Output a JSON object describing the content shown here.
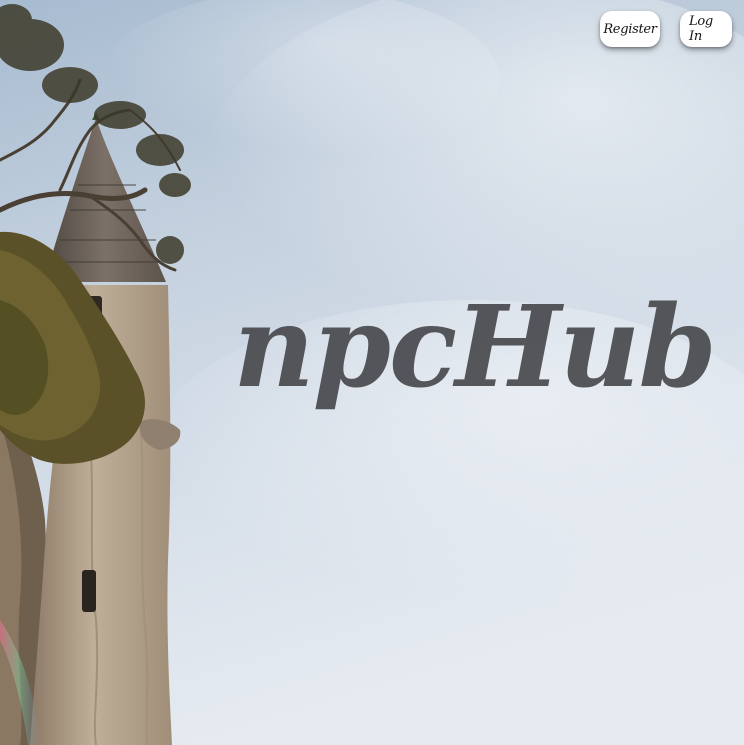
{
  "nav": {
    "register_label": "Register",
    "login_label": "Log In"
  },
  "hero": {
    "brand_title": "npcHub",
    "background_image": "stone-tower-with-tree-against-cloudy-sky"
  },
  "colors": {
    "sky_top": "#a9bdd1",
    "sky_bottom": "#dfe6ee",
    "brand_text": "#4a4b4f",
    "button_bg": "#ffffff",
    "button_text": "#141414"
  }
}
